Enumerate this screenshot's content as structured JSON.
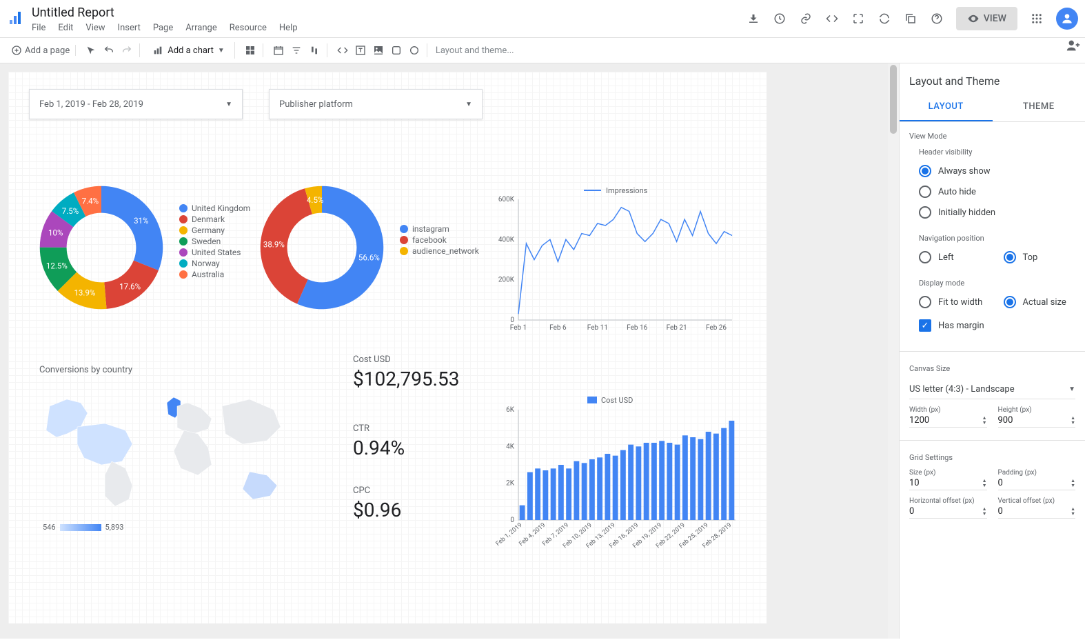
{
  "doc_title": "Untitled Report",
  "menu": [
    "File",
    "Edit",
    "View",
    "Insert",
    "Page",
    "Arrange",
    "Resource",
    "Help"
  ],
  "header_buttons": {
    "view": "VIEW"
  },
  "toolbar": {
    "add_page": "Add a page",
    "add_chart": "Add a chart",
    "layout_placeholder": "Layout and theme..."
  },
  "controls": {
    "date_range": "Feb 1, 2019 - Feb 28, 2019",
    "publisher": "Publisher platform"
  },
  "chart_data": [
    {
      "type": "pie",
      "variant": "donut",
      "series": [
        {
          "name": "United Kingdom",
          "value": 31,
          "color": "#4285f4"
        },
        {
          "name": "Denmark",
          "value": 17.6,
          "color": "#db4437"
        },
        {
          "name": "Germany",
          "value": 13.9,
          "color": "#f4b400"
        },
        {
          "name": "Sweden",
          "value": 12.5,
          "color": "#0f9d58"
        },
        {
          "name": "United States",
          "value": 10,
          "color": "#ab47bc"
        },
        {
          "name": "Norway",
          "value": 7.5,
          "color": "#00acc1"
        },
        {
          "name": "Australia",
          "value": 7.4,
          "color": "#ff7043"
        }
      ]
    },
    {
      "type": "pie",
      "variant": "donut",
      "series": [
        {
          "name": "instagram",
          "value": 56.6,
          "color": "#4285f4"
        },
        {
          "name": "facebook",
          "value": 38.9,
          "color": "#db4437"
        },
        {
          "name": "audience_network",
          "value": 4.5,
          "color": "#f4b400"
        }
      ]
    },
    {
      "type": "line",
      "title": "Impressions",
      "legend": "Impressions",
      "xlabel": "",
      "ylabel": "",
      "y_ticks": [
        0,
        "200K",
        "400K",
        "600K"
      ],
      "x_ticks": [
        "Feb 1",
        "Feb 6",
        "Feb 11",
        "Feb 16",
        "Feb 21",
        "Feb 26"
      ],
      "ylim": [
        0,
        600000
      ],
      "x": [
        "Feb 1",
        "Feb 2",
        "Feb 3",
        "Feb 4",
        "Feb 5",
        "Feb 6",
        "Feb 7",
        "Feb 8",
        "Feb 9",
        "Feb 10",
        "Feb 11",
        "Feb 12",
        "Feb 13",
        "Feb 14",
        "Feb 15",
        "Feb 16",
        "Feb 17",
        "Feb 18",
        "Feb 19",
        "Feb 20",
        "Feb 21",
        "Feb 22",
        "Feb 23",
        "Feb 24",
        "Feb 25",
        "Feb 26",
        "Feb 27",
        "Feb 28"
      ],
      "values": [
        30000,
        380000,
        300000,
        370000,
        400000,
        290000,
        400000,
        350000,
        430000,
        420000,
        480000,
        470000,
        500000,
        560000,
        540000,
        430000,
        390000,
        430000,
        500000,
        480000,
        390000,
        500000,
        420000,
        540000,
        430000,
        380000,
        440000,
        420000
      ]
    },
    {
      "type": "bar",
      "title": "Cost USD",
      "legend": "Cost USD",
      "y_ticks": [
        0,
        "2K",
        "4K",
        "6K"
      ],
      "ylim": [
        0,
        6000
      ],
      "categories": [
        "Feb 1, 2019",
        "Feb 2",
        "Feb 3",
        "Feb 4, 2019",
        "Feb 5",
        "Feb 6",
        "Feb 7, 2019",
        "Feb 8",
        "Feb 9",
        "Feb 10, 2019",
        "Feb 11",
        "Feb 12",
        "Feb 13, 2019",
        "Feb 14",
        "Feb 15",
        "Feb 16, 2019",
        "Feb 17",
        "Feb 18",
        "Feb 19, 2019",
        "Feb 20",
        "Feb 21",
        "Feb 22, 2019",
        "Feb 23",
        "Feb 24",
        "Feb 25, 2019",
        "Feb 26",
        "Feb 27",
        "Feb 28, 2019"
      ],
      "x_tick_labels": [
        "Feb 1, 2019",
        "Feb 4, 2019",
        "Feb 7, 2019",
        "Feb 10, 2019",
        "Feb 13, 2019",
        "Feb 16, 2019",
        "Feb 19, 2019",
        "Feb 22, 2019",
        "Feb 25, 2019",
        "Feb 28, 2019"
      ],
      "values": [
        800,
        2600,
        2800,
        2700,
        2800,
        3000,
        2800,
        3200,
        3100,
        3300,
        3400,
        3600,
        3500,
        3800,
        4100,
        4000,
        4200,
        4200,
        4300,
        4200,
        4100,
        4600,
        4500,
        4400,
        4800,
        4700,
        5000,
        5400
      ]
    }
  ],
  "scorecards": {
    "cost": {
      "label": "Cost USD",
      "value": "$102,795.53"
    },
    "ctr": {
      "label": "CTR",
      "value": "0.94%"
    },
    "cpc": {
      "label": "CPC",
      "value": "$0.96"
    }
  },
  "map": {
    "title": "Conversions by country",
    "scale_min": "546",
    "scale_max": "5,893"
  },
  "panel": {
    "title": "Layout and Theme",
    "tabs": {
      "layout": "LAYOUT",
      "theme": "THEME"
    },
    "view_mode": {
      "heading": "View Mode",
      "header_visibility": "Header visibility",
      "opts": {
        "always": "Always show",
        "auto": "Auto hide",
        "initial": "Initially hidden"
      },
      "nav_position": "Navigation position",
      "nav_opts": {
        "left": "Left",
        "top": "Top"
      },
      "display_mode": "Display mode",
      "display_opts": {
        "fit": "Fit to width",
        "actual": "Actual size"
      },
      "margin": "Has margin"
    },
    "canvas_size": {
      "heading": "Canvas Size",
      "preset": "US letter (4:3) - Landscape",
      "width_label": "Width (px)",
      "width": "1200",
      "height_label": "Height (px)",
      "height": "900"
    },
    "grid": {
      "heading": "Grid Settings",
      "size_label": "Size (px)",
      "size": "10",
      "padding_label": "Padding (px)",
      "padding": "0",
      "h_offset_label": "Horizontal offset (px)",
      "h_offset": "0",
      "v_offset_label": "Vertical offset (px)",
      "v_offset": "0"
    }
  }
}
